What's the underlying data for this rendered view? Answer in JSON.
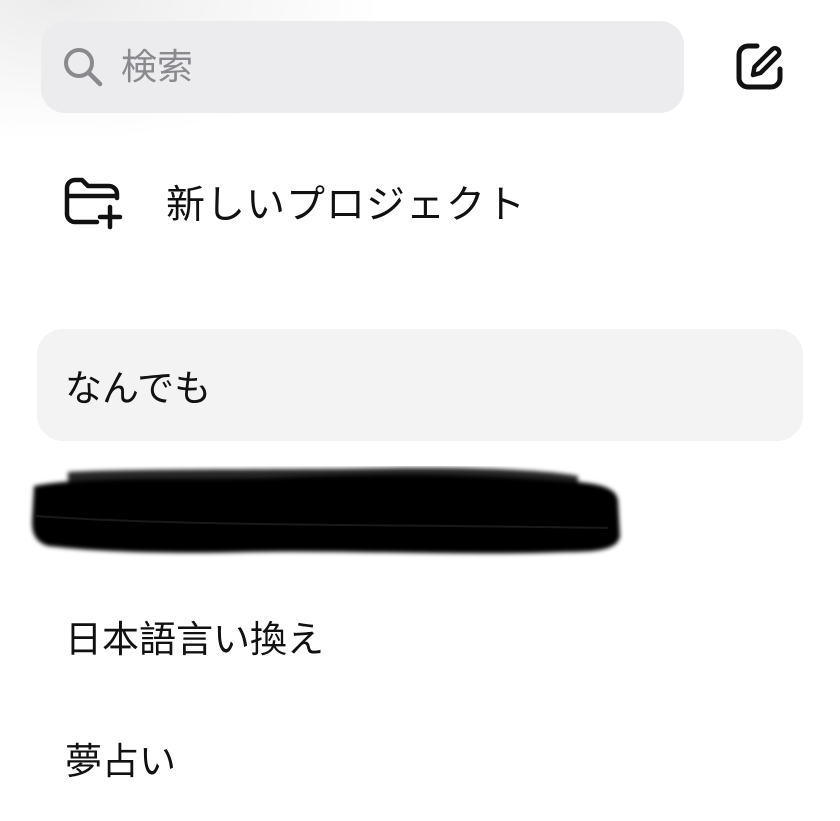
{
  "search": {
    "placeholder": "検索",
    "value": ""
  },
  "icons": {
    "search": "search-icon",
    "compose": "compose-icon",
    "new_folder": "folder-plus-icon"
  },
  "new_project": {
    "label": "新しいプロジェクト"
  },
  "chats": [
    {
      "title": "なんでも",
      "selected": true
    },
    {
      "title": "",
      "redacted": true
    },
    {
      "title": "日本語言い換え",
      "selected": false
    },
    {
      "title": "夢占い",
      "selected": false
    }
  ],
  "colors": {
    "search_bg": "#ececef",
    "selected_bg": "#f3f3f4",
    "placeholder": "#8a8a8e",
    "text": "#111111"
  }
}
